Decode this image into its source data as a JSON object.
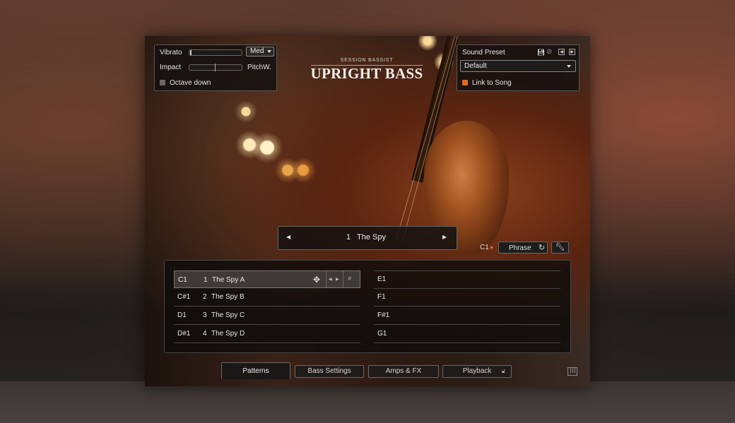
{
  "top_left": {
    "vibrato_label": "Vibrato",
    "vibrato_dropdown": "Med",
    "impact_label": "Impact",
    "pitchw_label": "PitchW.",
    "octave_down_label": "Octave down"
  },
  "brand": {
    "subtitle": "SESSION BASSIST",
    "title": "UPRIGHT BASS"
  },
  "sound_preset": {
    "label": "Sound Preset",
    "value": "Default",
    "link_to_song": "Link to Song"
  },
  "pattern_nav": {
    "number": "1",
    "name": "The Spy"
  },
  "phrase_bar": {
    "key": "C1",
    "phrase_label": "Phrase"
  },
  "left_rows": [
    {
      "note": "C1",
      "num": "1",
      "name": "The Spy A"
    },
    {
      "note": "C#1",
      "num": "2",
      "name": "The Spy B"
    },
    {
      "note": "D1",
      "num": "3",
      "name": "The Spy C"
    },
    {
      "note": "D#1",
      "num": "4",
      "name": "The Spy D"
    }
  ],
  "right_rows": [
    {
      "note": "E1"
    },
    {
      "note": "F1"
    },
    {
      "note": "F#1"
    },
    {
      "note": "G1"
    }
  ],
  "tabs": {
    "patterns": "Patterns",
    "bass_settings": "Bass Settings",
    "amps_fx": "Amps & FX",
    "playback": "Playback"
  },
  "colors": {
    "accent": "#e36a1a"
  }
}
